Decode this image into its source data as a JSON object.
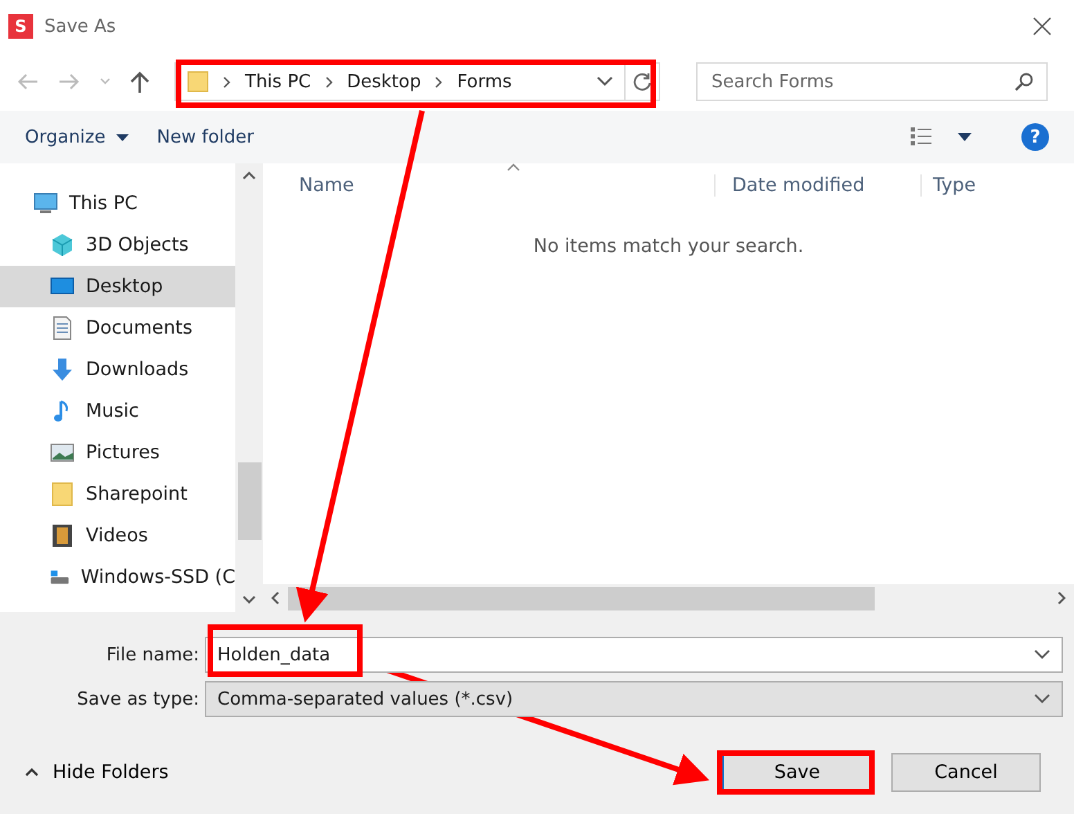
{
  "window": {
    "title": "Save As",
    "app_letter": "S"
  },
  "address": {
    "crumbs": [
      "This PC",
      "Desktop",
      "Forms"
    ]
  },
  "search": {
    "placeholder": "Search Forms"
  },
  "toolbar": {
    "organize": "Organize",
    "new_folder": "New folder",
    "help": "?"
  },
  "sidebar": {
    "items": [
      {
        "label": "This PC",
        "selected": false
      },
      {
        "label": "3D Objects",
        "selected": false
      },
      {
        "label": "Desktop",
        "selected": true
      },
      {
        "label": "Documents",
        "selected": false
      },
      {
        "label": "Downloads",
        "selected": false
      },
      {
        "label": "Music",
        "selected": false
      },
      {
        "label": "Pictures",
        "selected": false
      },
      {
        "label": "Sharepoint",
        "selected": false
      },
      {
        "label": "Videos",
        "selected": false
      },
      {
        "label": "Windows-SSD (C",
        "selected": false
      }
    ]
  },
  "table": {
    "columns": [
      "Name",
      "Date modified",
      "Type"
    ],
    "empty_message": "No items match your search."
  },
  "form": {
    "file_name_label": "File name:",
    "file_name": "Holden_data",
    "type_label": "Save as type:",
    "type_value": "Comma-separated values (*.csv)"
  },
  "footer": {
    "hide_folders": "Hide Folders",
    "buttons": [
      "Save",
      "Cancel"
    ]
  }
}
